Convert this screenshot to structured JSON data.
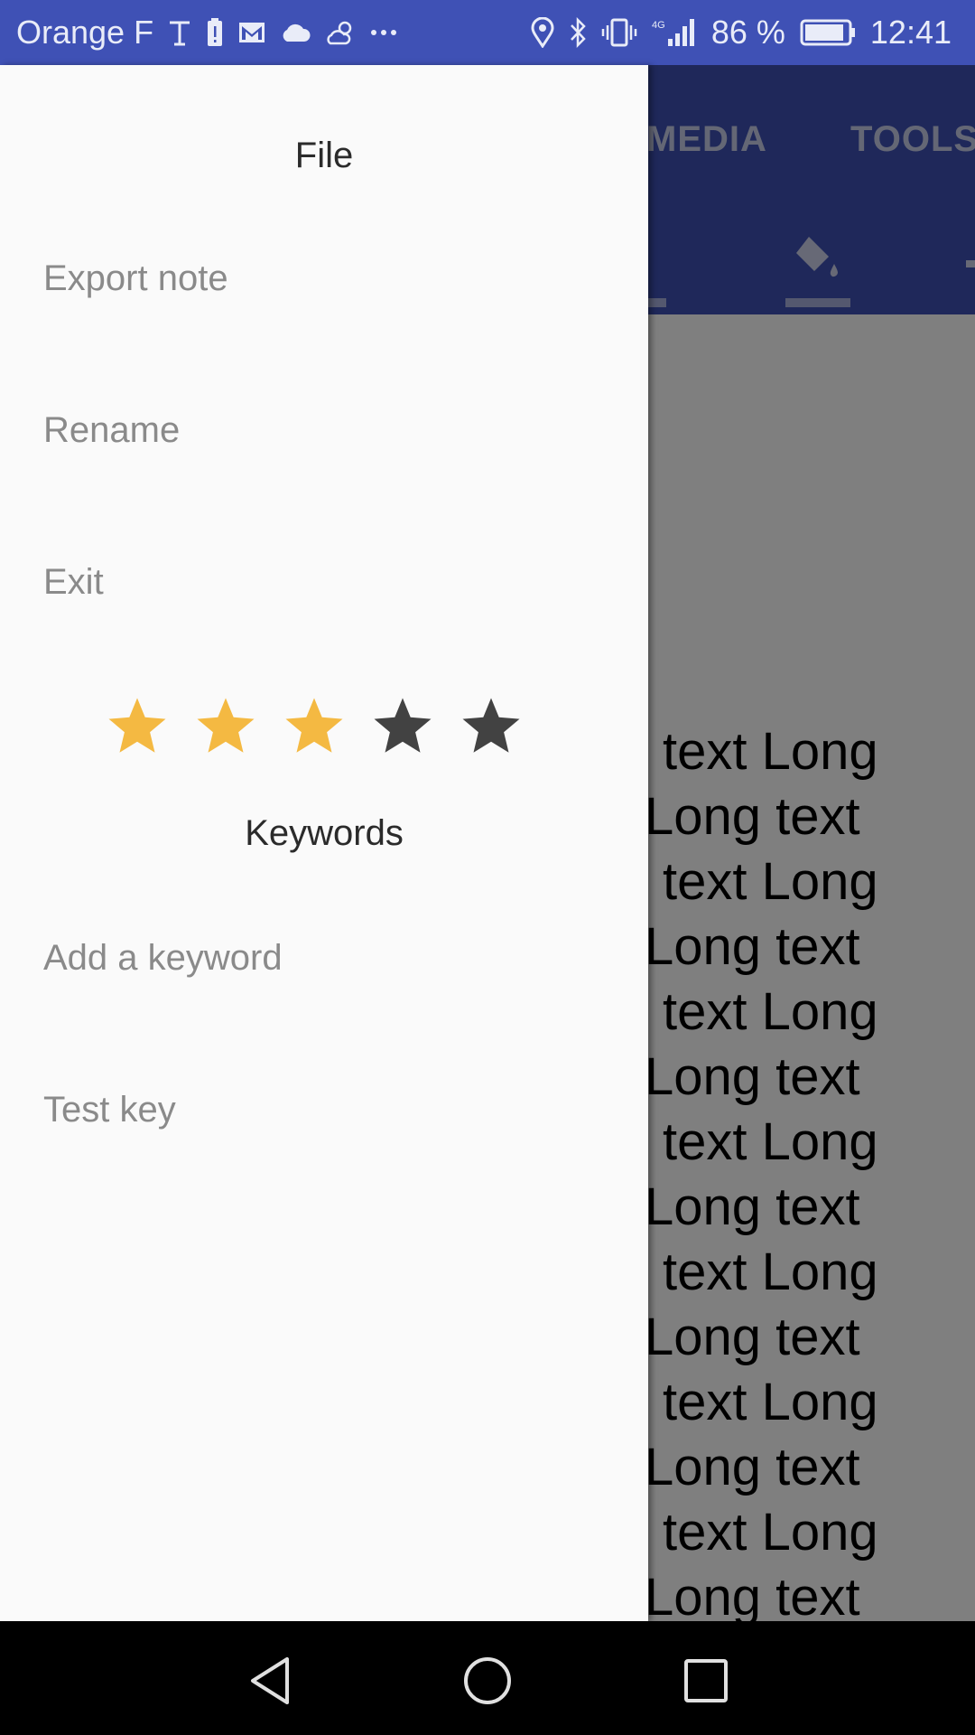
{
  "status_bar": {
    "carrier": "Orange F",
    "battery_percent": "86 %",
    "time": "12:41"
  },
  "app": {
    "tabs": [
      "MEDIA",
      "TOOLS"
    ],
    "content_lines": [
      " text Long",
      "Long text",
      " text Long",
      "Long text",
      " text Long",
      "Long text",
      " text Long",
      "Long text",
      " text Long",
      "Long text",
      " text Long",
      "Long text",
      " text Long",
      "Long text"
    ]
  },
  "drawer": {
    "file_title": "File",
    "file_items": [
      "Export note",
      "Rename",
      "Exit"
    ],
    "rating": {
      "value": 3,
      "max": 5
    },
    "keywords_title": "Keywords",
    "keyword_items": [
      "Add a keyword",
      "Test key"
    ]
  },
  "colors": {
    "primary": "#3f51b5",
    "star_filled": "#f4b942",
    "star_empty": "#424242"
  }
}
